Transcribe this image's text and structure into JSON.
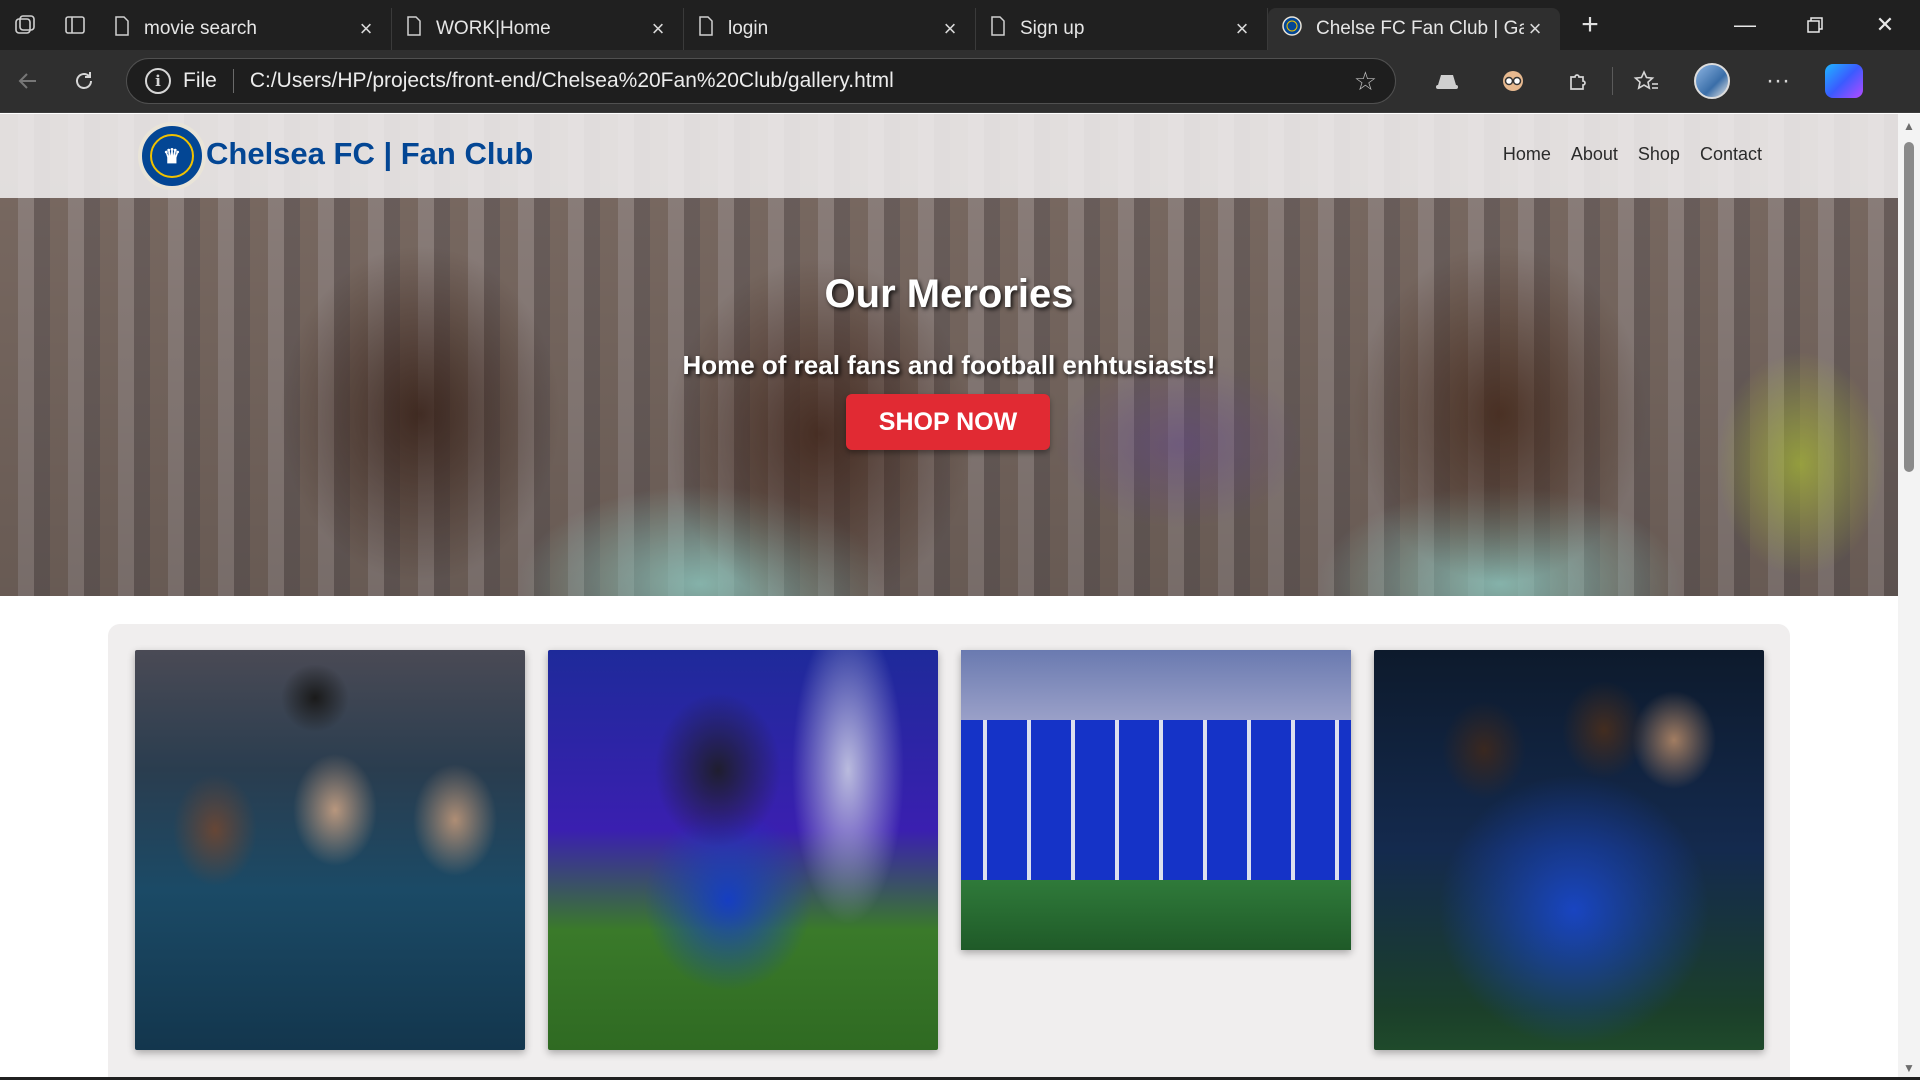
{
  "browser": {
    "tabs": [
      {
        "title": "movie search",
        "active": false
      },
      {
        "title": "WORK|Home",
        "active": false
      },
      {
        "title": "login",
        "active": false
      },
      {
        "title": "Sign up",
        "active": false
      },
      {
        "title": "Chelse FC Fan Club | Galle",
        "active": true
      }
    ],
    "new_tab_label": "+",
    "url_scheme": "File",
    "url": "C:/Users/HP/projects/front-end/Chelsea%20Fan%20Club/gallery.html"
  },
  "site": {
    "brand": "Chelsea FC | Fan Club",
    "nav": [
      "Home",
      "About",
      "Shop",
      "Contact"
    ]
  },
  "hero": {
    "title": "Our Merories",
    "subtitle": "Home of real fans and football enhtusiasts!",
    "cta": "SHOP NOW"
  },
  "gallery": {
    "photos": [
      {
        "name": "trophy-celebration"
      },
      {
        "name": "kneeling-player"
      },
      {
        "name": "team-lineup"
      },
      {
        "name": "players-celebrating"
      }
    ]
  },
  "colors": {
    "brand_blue": "#034694",
    "cta_red": "#e12a33",
    "gallery_bg": "#f0eeee"
  }
}
